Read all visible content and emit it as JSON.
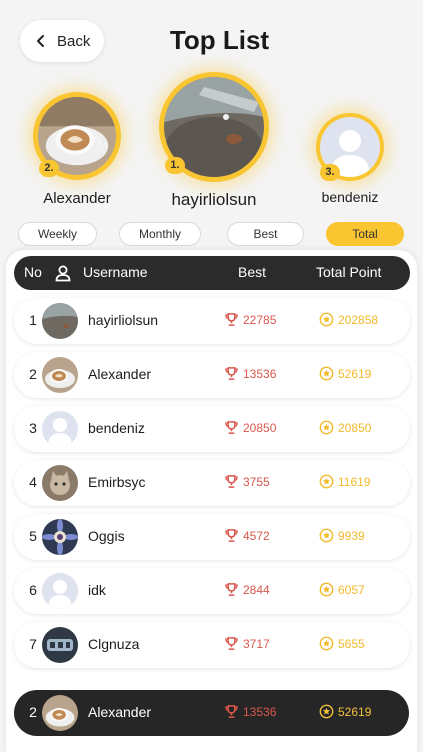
{
  "header": {
    "back_label": "Back",
    "title": "Top List"
  },
  "podium": [
    {
      "rank": "1.",
      "name": "hayirliolsun"
    },
    {
      "rank": "2.",
      "name": "Alexander"
    },
    {
      "rank": "3.",
      "name": "bendeniz"
    }
  ],
  "tabs": [
    {
      "label": "Weekly",
      "active": false
    },
    {
      "label": "Monthly",
      "active": false
    },
    {
      "label": "Best",
      "active": false
    },
    {
      "label": "Total",
      "active": true
    }
  ],
  "table": {
    "headers": {
      "no": "No",
      "username": "Username",
      "best": "Best",
      "total": "Total Point"
    },
    "rows": [
      {
        "no": "1",
        "username": "hayirliolsun",
        "best": "22785",
        "total": "202858",
        "avatar": "avatar-photo-table"
      },
      {
        "no": "2",
        "username": "Alexander",
        "best": "13536",
        "total": "52619",
        "avatar": "avatar-photo-coffee"
      },
      {
        "no": "3",
        "username": "bendeniz",
        "best": "20850",
        "total": "20850",
        "avatar": "avatar-default-icon"
      },
      {
        "no": "4",
        "username": "Emirbsyc",
        "best": "3755",
        "total": "11619",
        "avatar": "avatar-photo-cat"
      },
      {
        "no": "5",
        "username": "Oggis",
        "best": "4572",
        "total": "9939",
        "avatar": "avatar-photo-flower"
      },
      {
        "no": "6",
        "username": "idk",
        "best": "2844",
        "total": "6057",
        "avatar": "avatar-default-icon"
      },
      {
        "no": "7",
        "username": "Clgnuza",
        "best": "3717",
        "total": "5655",
        "avatar": "avatar-photo-dark"
      }
    ]
  },
  "current_user": {
    "no": "2",
    "username": "Alexander",
    "best": "13536",
    "total": "52619",
    "avatar": "avatar-photo-coffee"
  },
  "colors": {
    "accent": "#f9c531",
    "best": "#d9574e",
    "total": "#f2b92a",
    "dark": "#2b2b2b"
  }
}
